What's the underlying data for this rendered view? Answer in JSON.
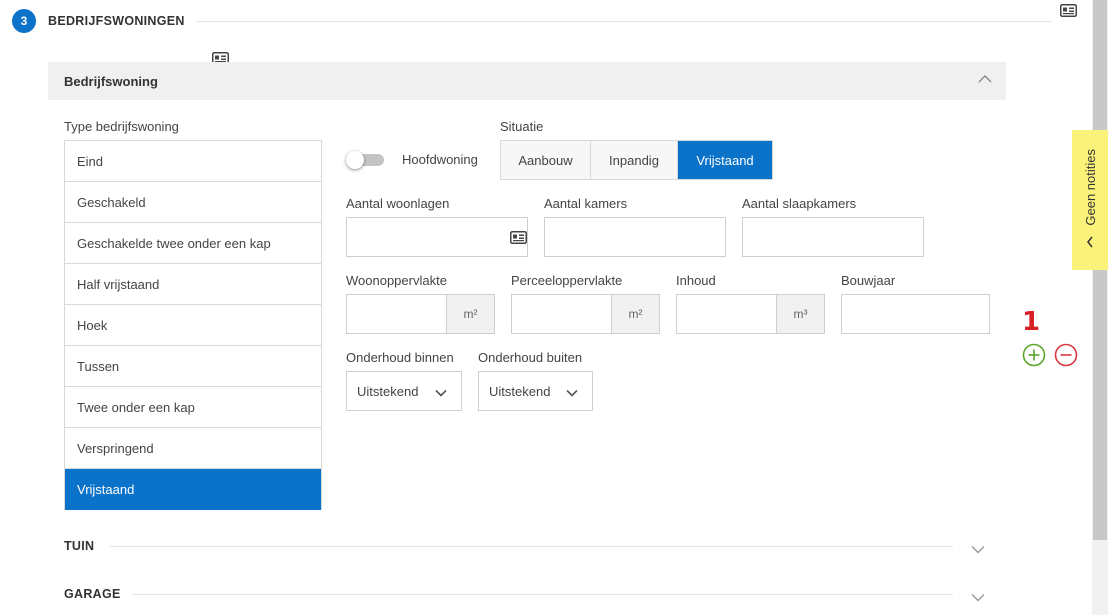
{
  "step": {
    "number": "3",
    "title": "BEDRIJFSWONINGEN"
  },
  "icons": {
    "card": "id-card-icon",
    "chevron_up": "chevron-up-icon",
    "chevron_down": "chevron-down-icon",
    "chevron_left": "chevron-left-icon",
    "plus": "plus-circle-icon",
    "minus": "minus-circle-icon"
  },
  "colors": {
    "accent": "#0a72c9",
    "notes_bg": "#fbf27a",
    "rating": "#d81f26",
    "plus": "#5aa52b",
    "minus": "#d9383f"
  },
  "notes_tab": {
    "label": "Geen notities"
  },
  "section": {
    "title": "Bedrijfswoning",
    "type_label": "Type bedrijfswoning",
    "types": [
      {
        "label": "Eind",
        "active": false
      },
      {
        "label": "Geschakeld",
        "active": false
      },
      {
        "label": "Geschakelde twee onder een kap",
        "active": false
      },
      {
        "label": "Half vrijstaand",
        "active": false
      },
      {
        "label": "Hoek",
        "active": false
      },
      {
        "label": "Tussen",
        "active": false
      },
      {
        "label": "Twee onder een kap",
        "active": false
      },
      {
        "label": "Verspringend",
        "active": false
      },
      {
        "label": "Vrijstaand",
        "active": true
      }
    ],
    "toggle": {
      "label": "Hoofdwoning",
      "on": false
    },
    "situatie": {
      "label": "Situatie",
      "options": [
        "Aanbouw",
        "Inpandig",
        "Vrijstaand"
      ],
      "selected": "Vrijstaand"
    },
    "fields_row1": [
      {
        "label": "Aantal woonlagen",
        "value": "",
        "has_icon": true
      },
      {
        "label": "Aantal kamers",
        "value": ""
      },
      {
        "label": "Aantal slaapkamers",
        "value": ""
      }
    ],
    "fields_row2": [
      {
        "label": "Woonoppervlakte",
        "value": "",
        "unit": "m²"
      },
      {
        "label": "Perceeloppervlakte",
        "value": "",
        "unit": "m²"
      },
      {
        "label": "Inhoud",
        "value": "",
        "unit": "m³"
      },
      {
        "label": "Bouwjaar",
        "value": ""
      }
    ],
    "maintenance": [
      {
        "label": "Onderhoud binnen",
        "value": "Uitstekend"
      },
      {
        "label": "Onderhoud buiten",
        "value": "Uitstekend"
      }
    ],
    "count": "1"
  },
  "collapsed_sections": [
    {
      "title": "TUIN"
    },
    {
      "title": "GARAGE"
    }
  ]
}
